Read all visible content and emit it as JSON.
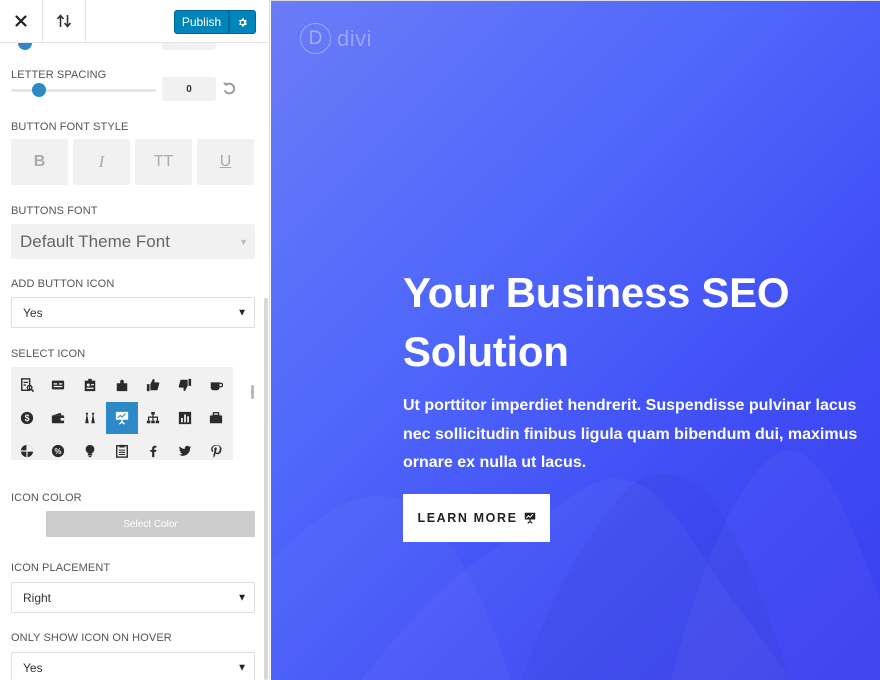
{
  "toolbar": {
    "close_icon": "close-icon",
    "reorder_icon": "reorder-arrows-icon",
    "publish_label": "Publish",
    "gear_icon": "gear-icon"
  },
  "controls": {
    "letter_spacing": {
      "label": "LETTER SPACING",
      "value": "0",
      "reset_icon": "reset-icon"
    },
    "button_font_style": {
      "label": "BUTTON FONT STYLE",
      "bold": "B",
      "italic": "I",
      "uppercase": "TT",
      "underline": "U"
    },
    "buttons_font": {
      "label": "BUTTONS FONT",
      "value": "Default Theme Font"
    },
    "add_button_icon": {
      "label": "ADD BUTTON ICON",
      "value": "Yes"
    },
    "select_icon": {
      "label": "SELECT ICON",
      "icons": [
        "search-document-icon",
        "id-card-icon",
        "contact-card-icon",
        "puzzle-icon",
        "thumbs-up-icon",
        "thumbs-down-icon",
        "coffee-cup-icon",
        "dollar-coin-icon",
        "wallet-icon",
        "tie-icon",
        "presentation-icon",
        "sitemap-icon",
        "bar-chart-icon",
        "briefcase-icon",
        "shield-icon",
        "percent-icon",
        "lightbulb-icon",
        "clipboard-icon",
        "facebook-icon",
        "twitter-icon",
        "pinterest-icon"
      ],
      "selected": "presentation-icon"
    },
    "icon_color": {
      "label": "ICON COLOR",
      "button": "Select Color"
    },
    "icon_placement": {
      "label": "ICON PLACEMENT",
      "value": "Right"
    },
    "only_show_on_hover": {
      "label": "ONLY SHOW ICON ON HOVER",
      "value": "Yes"
    }
  },
  "preview": {
    "logo_text": "divi",
    "logo_letter": "D",
    "title": "Your Business SEO Solution",
    "text": "Ut porttitor imperdiet hendrerit. Suspendisse pulvinar lacus nec sollicitudin finibus ligula quam bibendum dui, maximus ornare ex nulla ut lacus.",
    "button_label": "LEARN MORE",
    "button_icon": "presentation-icon"
  },
  "colors": {
    "accent": "#2e89c7",
    "publish": "#0085ba",
    "gradient_start": "#6a7cf7",
    "gradient_end": "#3a3ff0"
  }
}
